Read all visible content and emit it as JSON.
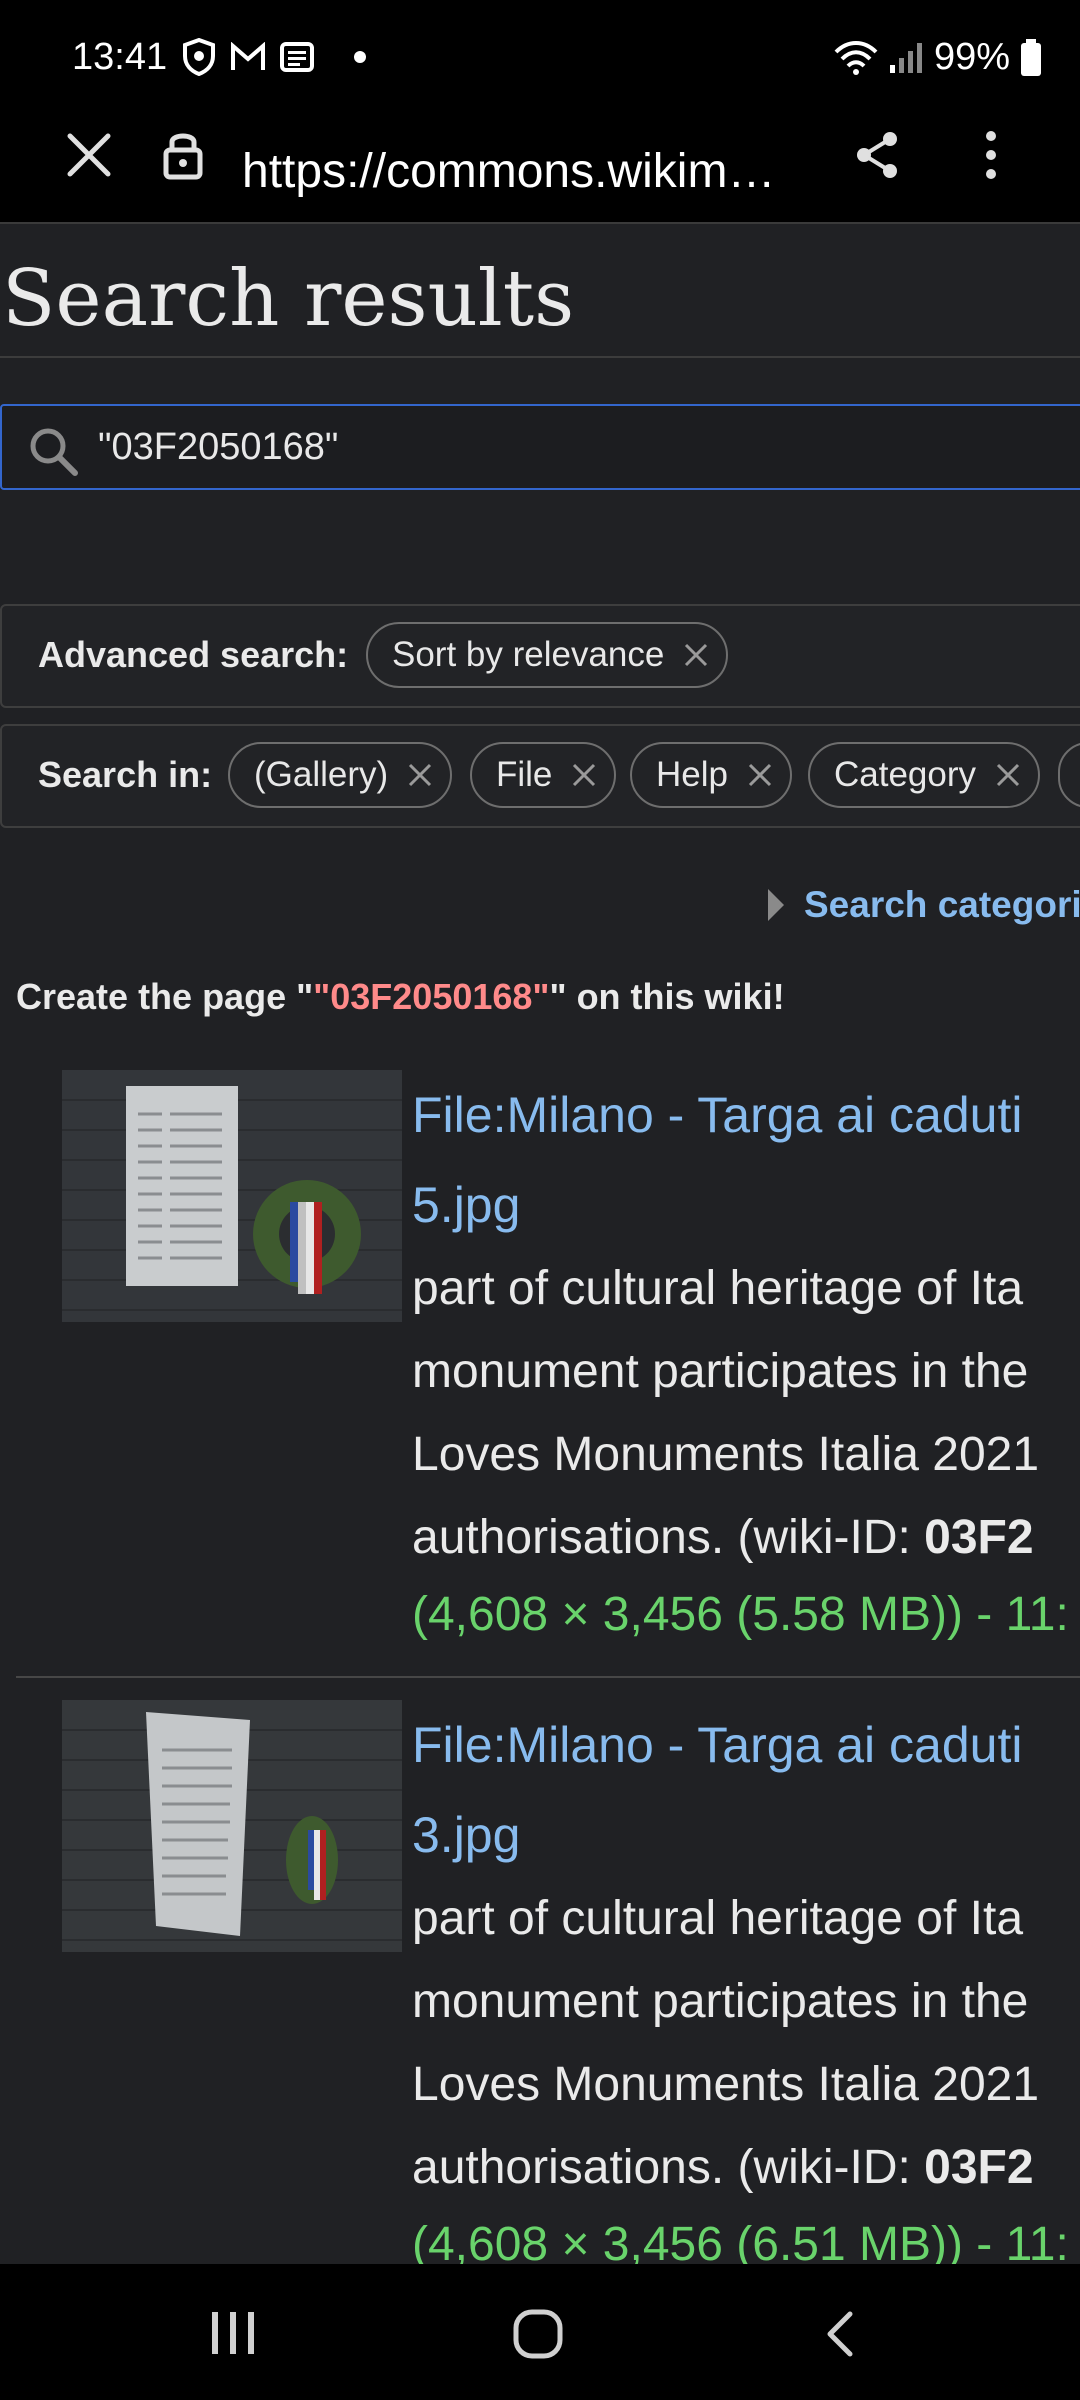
{
  "status_bar": {
    "time": "13:41",
    "battery": "99%",
    "icons": [
      "shield-icon",
      "gmail-icon",
      "news-icon",
      "notification-dot",
      "wifi-icon",
      "signal-icon",
      "battery-icon"
    ]
  },
  "browser": {
    "url": "https://commons.wikim…",
    "icons": [
      "close-icon",
      "lock-icon",
      "share-icon",
      "more-vert-icon"
    ]
  },
  "page": {
    "title": "Search results",
    "search": {
      "value": "\"03F2050168\""
    },
    "advanced": {
      "label": "Advanced search:",
      "chip": "Sort by relevance"
    },
    "search_in": {
      "label": "Search in:",
      "chips": [
        "(Gallery)",
        "File",
        "Help",
        "Category"
      ]
    },
    "category_toggle": "Search categori",
    "create": {
      "prefix": "Create the page \"",
      "term": "\"03F2050168\"",
      "suffix": "\" on this wiki!"
    },
    "results": [
      {
        "title_line1": "File:Milano - Targa ai caduti",
        "title_line2": "5.jpg",
        "desc_line1": "part of cultural heritage of Ita",
        "desc_line2": "monument participates in the",
        "desc_line3": "Loves Monuments Italia 2021",
        "desc_line4_prefix": "authorisations. (wiki-ID: ",
        "desc_line4_bold": "03F2",
        "meta": "(4,608 × 3,456 (5.58 MB)) - 11:"
      },
      {
        "title_line1": "File:Milano - Targa ai caduti",
        "title_line2": "3.jpg",
        "desc_line1": "part of cultural heritage of Ita",
        "desc_line2": "monument participates in the",
        "desc_line3": "Loves Monuments Italia 2021",
        "desc_line4_prefix": "authorisations. (wiki-ID: ",
        "desc_line4_bold": "03F2",
        "meta": "(4,608 × 3,456 (6.51 MB)) - 11:"
      }
    ]
  },
  "colors": {
    "background": "#202124",
    "link": "#88bbee",
    "meta": "#69d36b",
    "new_page_link": "#ff8a8a",
    "search_border": "#3366cc"
  }
}
